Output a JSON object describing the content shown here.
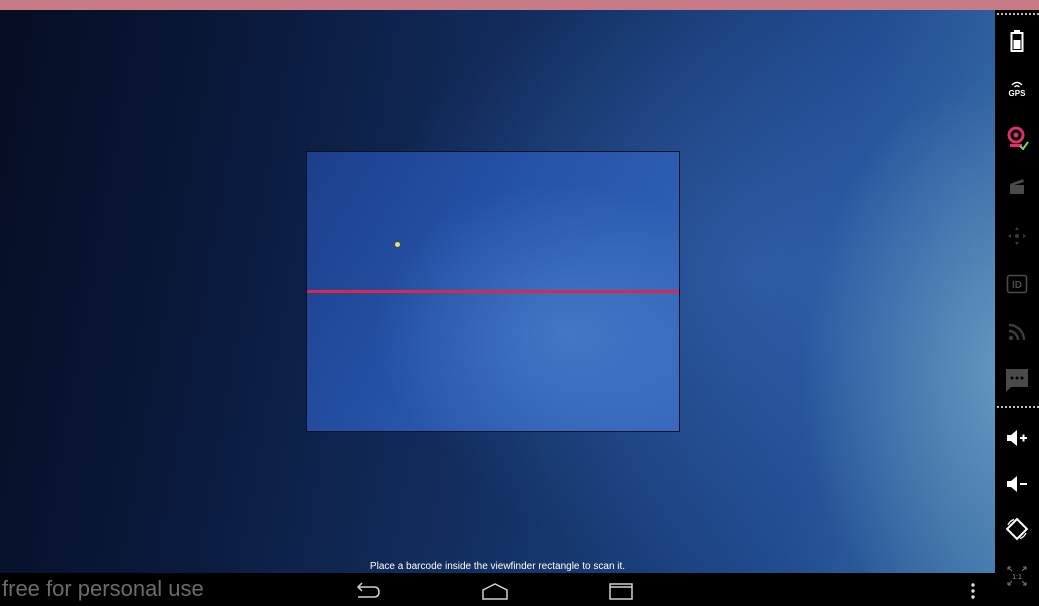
{
  "scanner": {
    "status_text": "Place a barcode inside the viewfinder rectangle to scan it."
  },
  "watermark": "free for personal use",
  "navbar": {
    "back": "back-icon",
    "home": "home-icon",
    "recent": "recent-apps-icon",
    "menu": "overflow-menu-icon"
  },
  "sidebar": {
    "icons": [
      "battery-icon",
      "gps-icon",
      "webcam-icon",
      "clapperboard-icon",
      "dpad-icon",
      "id-icon",
      "rss-icon",
      "sms-icon",
      "volume-up-icon",
      "volume-down-icon",
      "rotate-icon",
      "scale-icon"
    ],
    "scale_label": "1:1"
  },
  "colors": {
    "title_bar": "#c77b86",
    "laser": "#d9284a",
    "webcam_accent": "#e0306a"
  }
}
